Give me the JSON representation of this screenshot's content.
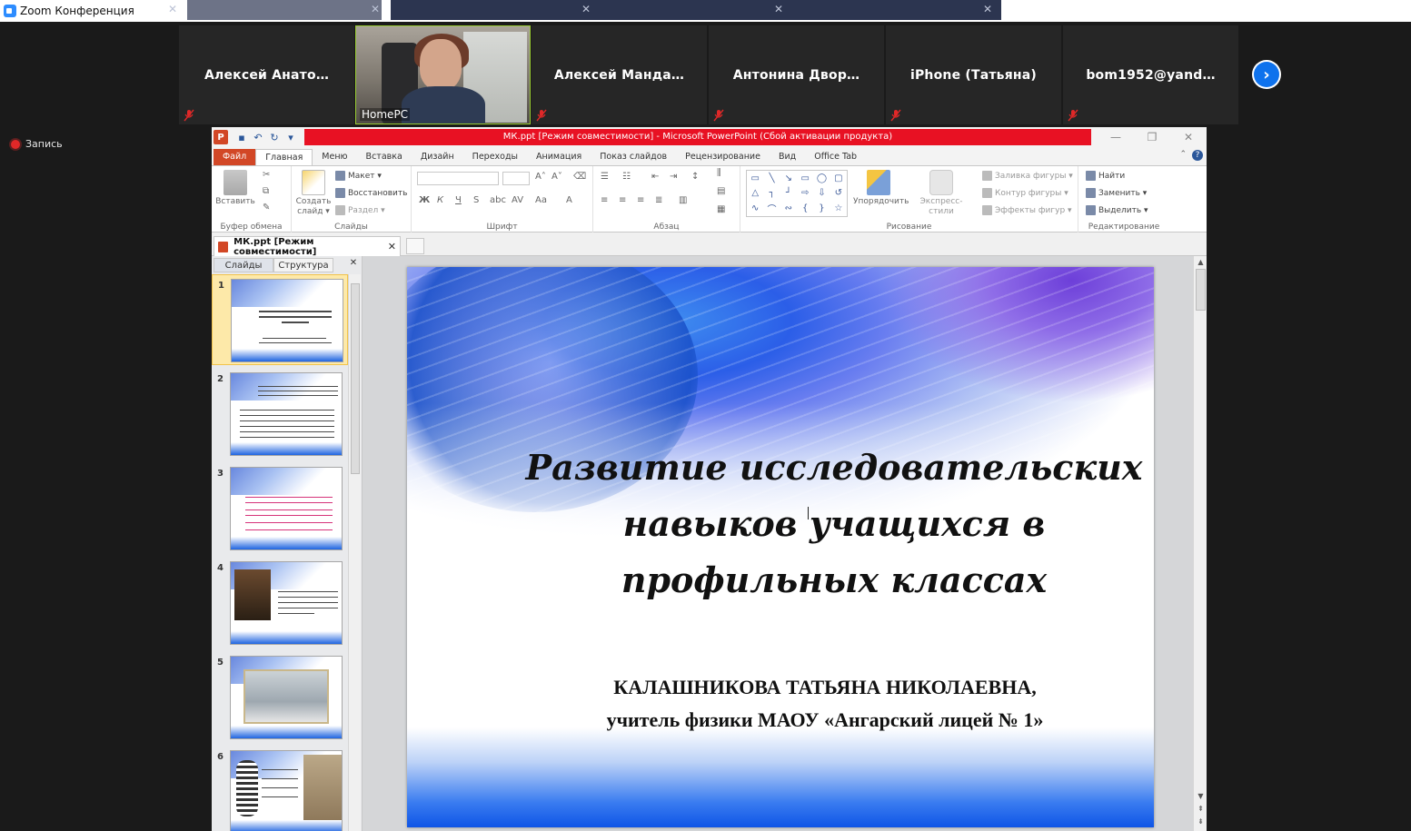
{
  "zoom": {
    "title": "Zoom Конференция",
    "recording_label": "Запись",
    "participants": [
      {
        "name": "Алексей  Анато…",
        "muted": true,
        "video": false
      },
      {
        "name": "HomePC",
        "muted": false,
        "video": true
      },
      {
        "name": "Алексей  Манда…",
        "muted": true,
        "video": false
      },
      {
        "name": "Антонина  Двор…",
        "muted": true,
        "video": false
      },
      {
        "name": "iPhone (Татьяна)",
        "muted": true,
        "video": false
      },
      {
        "name": "bom1952@yand…",
        "muted": true,
        "video": false
      }
    ],
    "next_icon": "chevron-right-icon",
    "accent_color": "#0e72ed",
    "muted_icon_color": "#e02828"
  },
  "ppt": {
    "title": "МК.ppt [Режим совместимости]  -  Microsoft PowerPoint (Сбой активации продукта)",
    "tabs": [
      "Файл",
      "Главная",
      "Меню",
      "Вставка",
      "Дизайн",
      "Переходы",
      "Анимация",
      "Показ слайдов",
      "Рецензирование",
      "Вид",
      "Office Tab"
    ],
    "active_tab": "Главная",
    "ribbon": {
      "clipboard": {
        "label": "Буфер обмена",
        "paste": "Вставить"
      },
      "slides": {
        "label": "Слайды",
        "create": "Создать слайд ▾",
        "layout": "Макет ▾",
        "reset": "Восстановить",
        "section": "Раздел ▾"
      },
      "font": {
        "label": "Шрифт"
      },
      "paragraph": {
        "label": "Абзац"
      },
      "drawing": {
        "label": "Рисование",
        "arrange": "Упорядочить",
        "quick_styles": "Экспресс-стили",
        "shape_fill": "Заливка фигуры ▾",
        "shape_outline": "Контур фигуры ▾",
        "shape_effects": "Эффекты фигур ▾"
      },
      "editing": {
        "label": "Редактирование",
        "find": "Найти",
        "replace": "Заменить ▾",
        "select": "Выделить ▾"
      }
    },
    "doc_tab": "МК.ppt [Режим совместимости]",
    "sidebar_tabs": [
      "Слайды",
      "Структура"
    ],
    "thumbnail_numbers": [
      "1",
      "2",
      "3",
      "4",
      "5",
      "6"
    ],
    "selected_slide": 1,
    "slide": {
      "title": "Развитие исследовательских навыков учащихся в профильных классах",
      "author_line1": "КАЛАШНИКОВА ТАТЬЯНА НИКОЛАЕВНА,",
      "author_line2": "учитель физики МАОУ «Ангарский лицей № 1»"
    }
  }
}
